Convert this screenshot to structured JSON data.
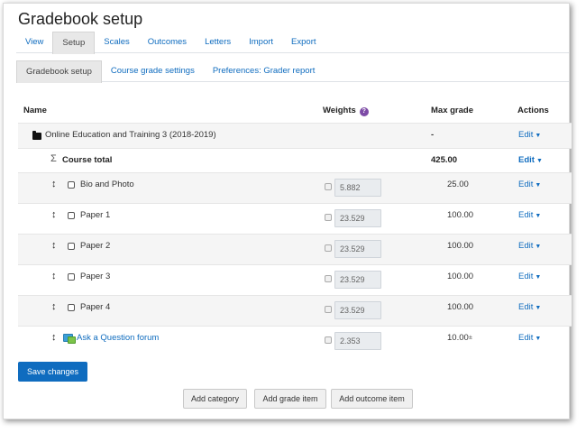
{
  "page": {
    "title": "Gradebook setup"
  },
  "tabs_primary": [
    {
      "label": "View",
      "active": false
    },
    {
      "label": "Setup",
      "active": true
    },
    {
      "label": "Scales",
      "active": false
    },
    {
      "label": "Outcomes",
      "active": false
    },
    {
      "label": "Letters",
      "active": false
    },
    {
      "label": "Import",
      "active": false
    },
    {
      "label": "Export",
      "active": false
    }
  ],
  "tabs_secondary": [
    {
      "label": "Gradebook setup",
      "active": true
    },
    {
      "label": "Course grade settings",
      "active": false
    },
    {
      "label": "Preferences: Grader report",
      "active": false
    }
  ],
  "table": {
    "headers": {
      "name": "Name",
      "weights": "Weights",
      "max_grade": "Max grade",
      "actions": "Actions"
    },
    "category": {
      "name": "Online Education and Training 3 (2018-2019)",
      "max_grade": "-",
      "action": "Edit"
    },
    "course_total": {
      "name": "Course total",
      "max_grade": "425.00",
      "action": "Edit"
    },
    "items": [
      {
        "name": "Bio and Photo",
        "weight": "5.882",
        "max_grade": "25.00",
        "action": "Edit",
        "is_link": false
      },
      {
        "name": "Paper 1",
        "weight": "23.529",
        "max_grade": "100.00",
        "action": "Edit",
        "is_link": false
      },
      {
        "name": "Paper 2",
        "weight": "23.529",
        "max_grade": "100.00",
        "action": "Edit",
        "is_link": false
      },
      {
        "name": "Paper 3",
        "weight": "23.529",
        "max_grade": "100.00",
        "action": "Edit",
        "is_link": false
      },
      {
        "name": "Paper 4",
        "weight": "23.529",
        "max_grade": "100.00",
        "action": "Edit",
        "is_link": false
      },
      {
        "name": "Ask a Question forum",
        "weight": "2.353",
        "max_grade": "10.00",
        "action": "Edit",
        "is_link": true
      }
    ]
  },
  "buttons": {
    "save": "Save changes",
    "add_category": "Add category",
    "add_grade_item": "Add grade item",
    "add_outcome_item": "Add outcome item"
  },
  "colors": {
    "accent": "#0f6cbf",
    "help": "#7d4ba6"
  }
}
